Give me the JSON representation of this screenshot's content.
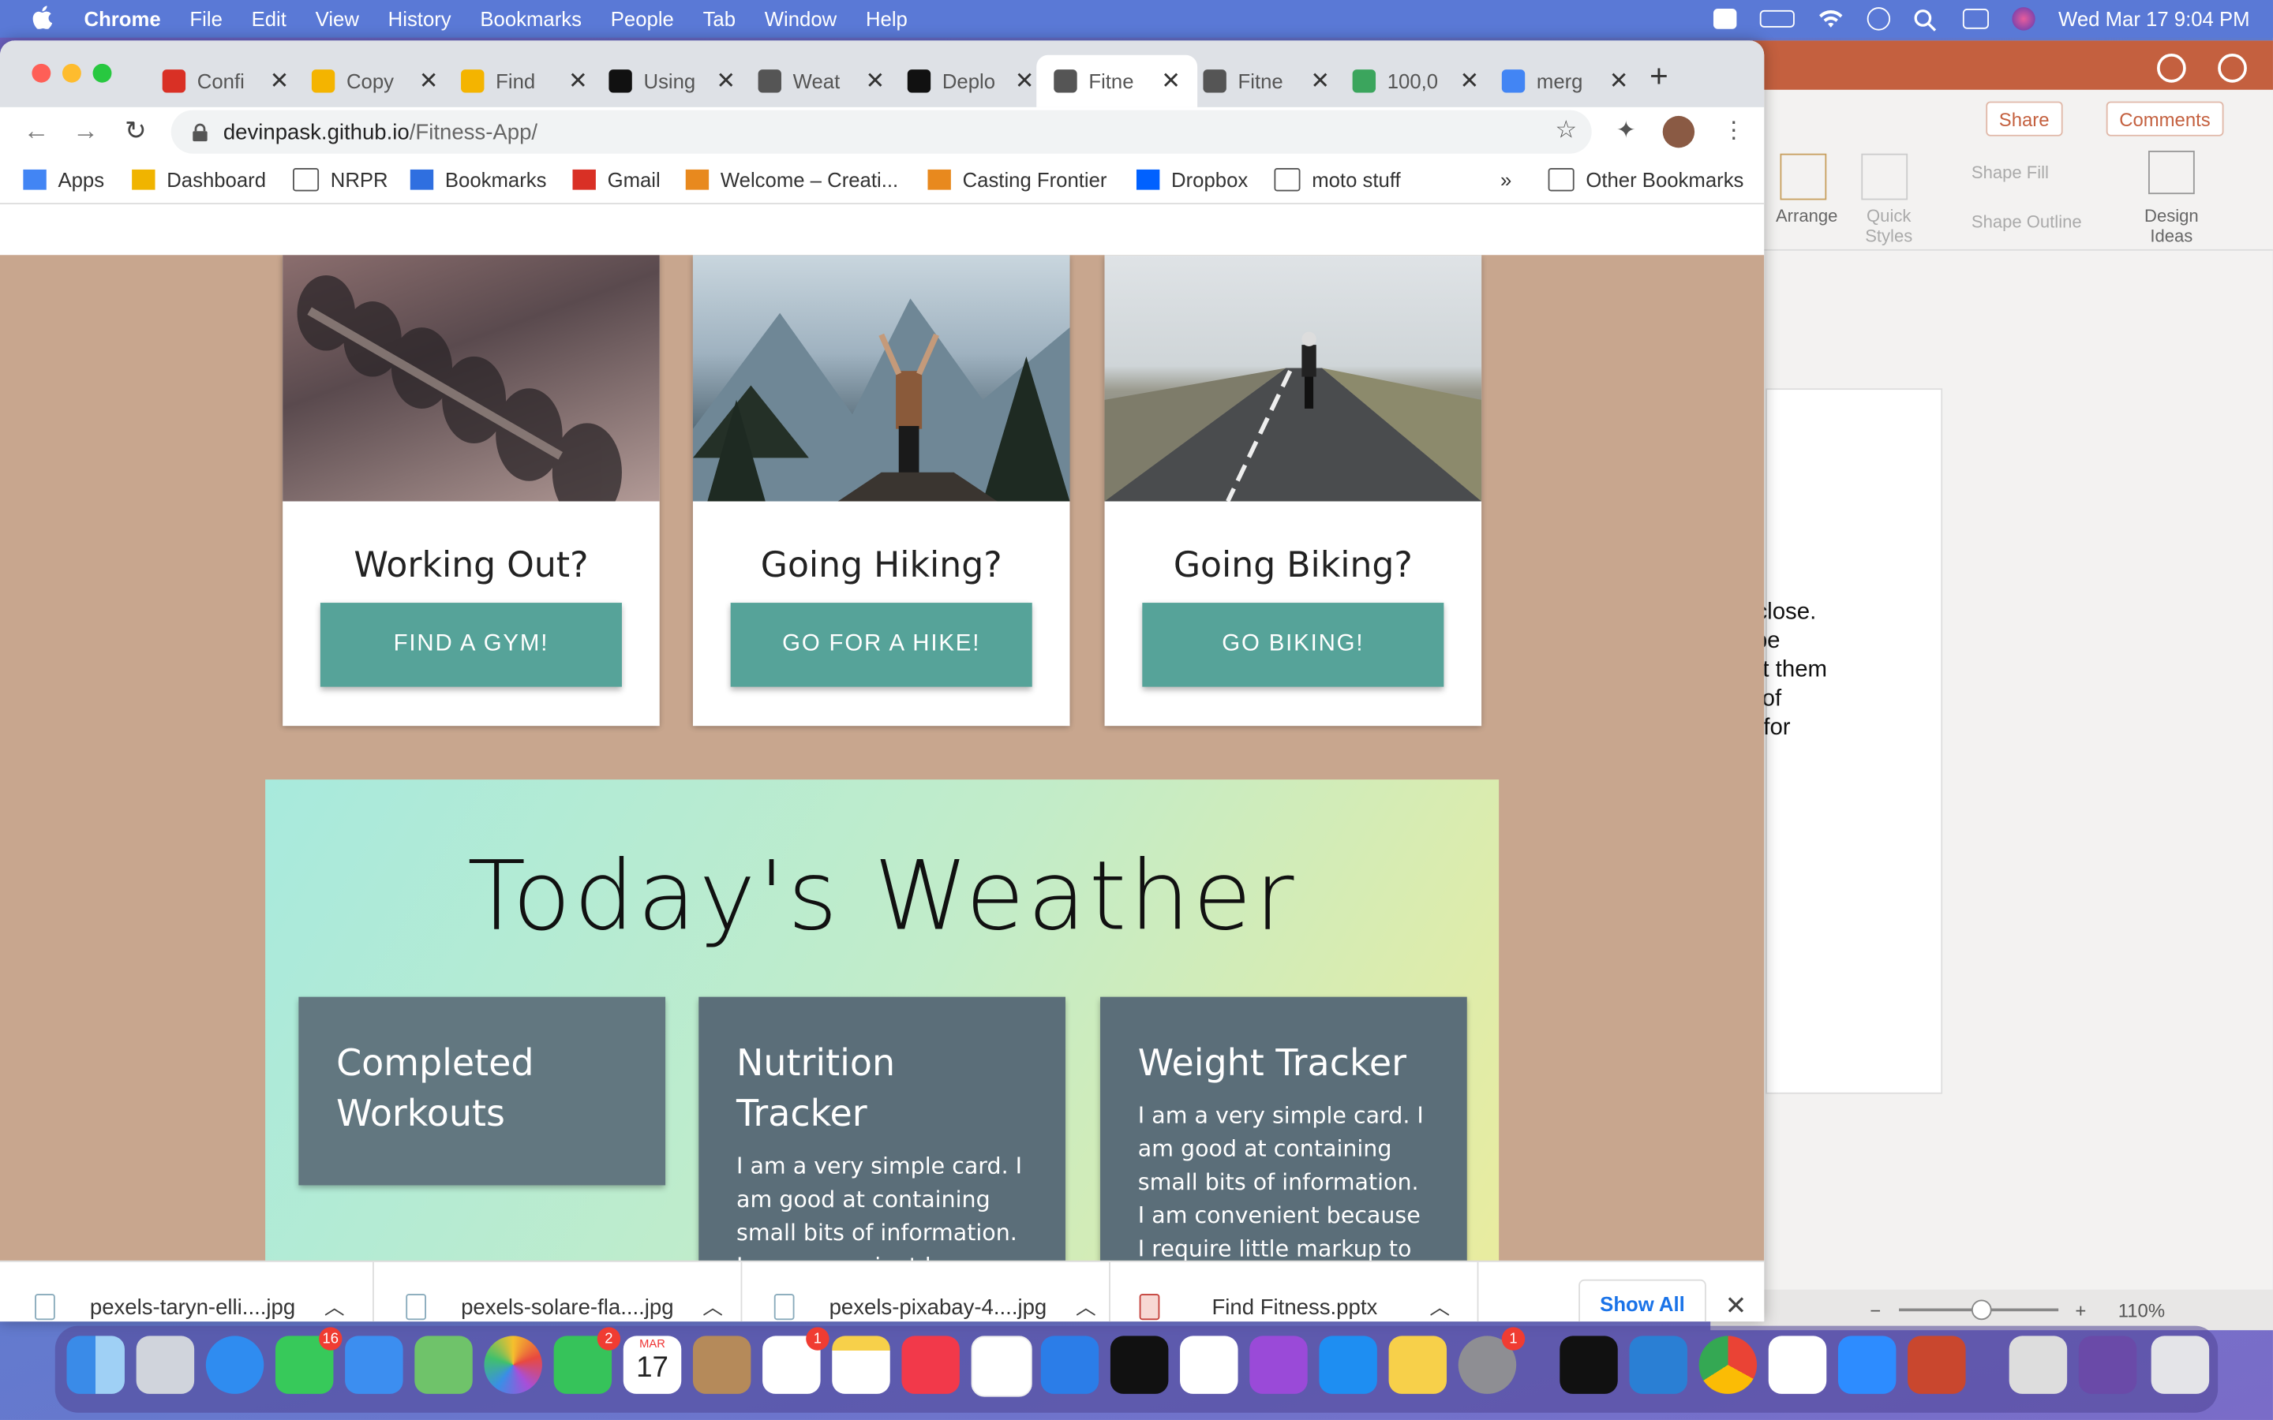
{
  "menubar": {
    "app": "Chrome",
    "items": [
      "File",
      "Edit",
      "View",
      "History",
      "Bookmarks",
      "People",
      "Tab",
      "Window",
      "Help"
    ],
    "clock": "Wed Mar 17  9:04 PM"
  },
  "tabs": [
    {
      "title": "Confi",
      "icon": "gmail-icon",
      "color": "#d93025"
    },
    {
      "title": "Copy",
      "icon": "slides-icon",
      "color": "#f4b400"
    },
    {
      "title": "Find",
      "icon": "slides-icon",
      "color": "#f4b400"
    },
    {
      "title": "Using",
      "icon": "site-icon",
      "color": "#111111"
    },
    {
      "title": "Weat",
      "icon": "globe-icon",
      "color": "#555555"
    },
    {
      "title": "Deplo",
      "icon": "github-icon",
      "color": "#111111"
    },
    {
      "title": "Fitne",
      "icon": "globe-icon",
      "color": "#555555",
      "active": true
    },
    {
      "title": "Fitne",
      "icon": "globe-icon",
      "color": "#555555"
    },
    {
      "title": "100,0",
      "icon": "doc-icon",
      "color": "#3ba55d"
    },
    {
      "title": "merg",
      "icon": "google-icon",
      "color": "#4285f4"
    }
  ],
  "omnibox": {
    "domain": "devinpask.github.io",
    "path": "/Fitness-App/"
  },
  "bookmarks": [
    {
      "label": "Apps",
      "icon": "apps-grid-icon"
    },
    {
      "label": "Dashboard",
      "icon": "dashboard-icon"
    },
    {
      "label": "NRPR",
      "icon": "folder-icon"
    },
    {
      "label": "Bookmarks",
      "icon": "star-icon"
    },
    {
      "label": "Gmail",
      "icon": "gmail-icon"
    },
    {
      "label": "Welcome – Creati...",
      "icon": "site-icon"
    },
    {
      "label": "Casting Frontier",
      "icon": "site-icon"
    },
    {
      "label": "Dropbox",
      "icon": "dropbox-icon"
    },
    {
      "label": "moto stuff",
      "icon": "folder-icon"
    }
  ],
  "bookmarks_more": "»",
  "other_bookmarks": "Other Bookmarks",
  "activity_cards": [
    {
      "title": "Working Out?",
      "button": "FIND A GYM!",
      "image": "dumbbells-photo"
    },
    {
      "title": "Going Hiking?",
      "button": "GO FOR A HIKE!",
      "image": "mountain-hiker-photo"
    },
    {
      "title": "Going Biking?",
      "button": "GO BIKING!",
      "image": "road-cyclist-photo"
    }
  ],
  "weather": {
    "heading": "Today's Weather",
    "cards": [
      {
        "title": "Completed Workouts",
        "body": ""
      },
      {
        "title": "Nutrition Tracker",
        "body": "I am a very simple card. I am good at containing small bits of information. I am convenient because I require little markup to use"
      },
      {
        "title": "Weight Tracker",
        "body": "I am a very simple card. I am good at containing small bits of information. I am convenient because I require little markup to use"
      }
    ]
  },
  "downloads": [
    {
      "name": "pexels-taryn-elli....jpg"
    },
    {
      "name": "pexels-solare-fla....jpg"
    },
    {
      "name": "pexels-pixabay-4....jpg"
    },
    {
      "name": "Find Fitness.pptx"
    }
  ],
  "downloads_show_all": "Show All",
  "powerpoint": {
    "share": "Share",
    "comments": "Comments",
    "arrange": "Arrange",
    "quick_styles": "Quick Styles",
    "shape_fill": "Shape Fill",
    "shape_outline": "Shape Outline",
    "design_ideas": "Design Ideas",
    "slide_text": [
      "to a close.",
      "s to be",
      "e'll let them",
      "click of",
      "area for"
    ],
    "zoom": "110%"
  },
  "dock_badges": {
    "messages": "16",
    "facetime": "2",
    "reminders": "1",
    "system_prefs": "1"
  },
  "calendar": {
    "month": "MAR",
    "day": "17"
  }
}
